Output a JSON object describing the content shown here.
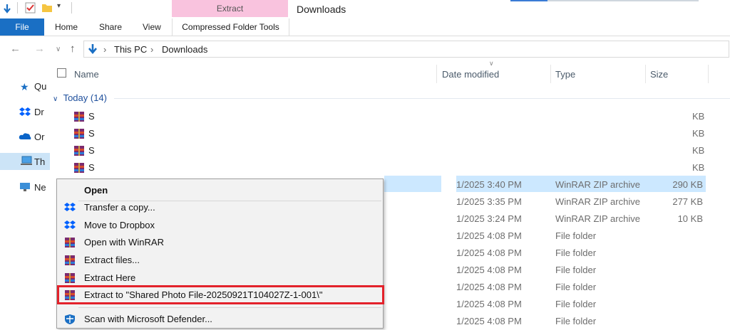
{
  "window": {
    "title": "Downloads"
  },
  "ribbon": {
    "context_tab": "Extract",
    "tabs": [
      "File",
      "Home",
      "Share",
      "View",
      "Compressed Folder Tools"
    ]
  },
  "address": {
    "crumbs": [
      "This PC",
      "Downloads"
    ]
  },
  "columns": {
    "name": "Name",
    "date": "Date modified",
    "type": "Type",
    "size": "Size"
  },
  "group": {
    "label": "Today (14)"
  },
  "sidebar": {
    "items": [
      "Qu",
      "Dr",
      "Or",
      "Th",
      "Ne"
    ]
  },
  "rows": [
    {
      "name": "S",
      "date": "",
      "type": "",
      "size": "KB"
    },
    {
      "name": "S",
      "date": "",
      "type": "",
      "size": "KB"
    },
    {
      "name": "S",
      "date": "",
      "type": "",
      "size": "KB"
    },
    {
      "name": "S",
      "date": "",
      "type": "",
      "size": "KB"
    },
    {
      "date": "1/2025 3:40 PM",
      "type": "WinRAR ZIP archive",
      "size": "290 KB"
    },
    {
      "date": "1/2025 3:35 PM",
      "type": "WinRAR ZIP archive",
      "size": "277 KB"
    },
    {
      "date": "1/2025 3:24 PM",
      "type": "WinRAR ZIP archive",
      "size": "10 KB"
    },
    {
      "date": "1/2025 4:08 PM",
      "type": "File folder",
      "size": ""
    },
    {
      "date": "1/2025 4:08 PM",
      "type": "File folder",
      "size": ""
    },
    {
      "date": "1/2025 4:08 PM",
      "type": "File folder",
      "size": ""
    },
    {
      "date": "1/2025 4:08 PM",
      "type": "File folder",
      "size": ""
    },
    {
      "date": "1/2025 4:08 PM",
      "type": "File folder",
      "size": ""
    },
    {
      "date": "1/2025 4:08 PM",
      "type": "File folder",
      "size": ""
    }
  ],
  "context_menu": {
    "items": [
      "Open",
      "Transfer a copy...",
      "Move to Dropbox",
      "Open with WinRAR",
      "Extract files...",
      "Extract Here",
      "Extract to \"Shared Photo File-20250921T104027Z-1-001\\\"",
      "Scan with Microsoft Defender..."
    ]
  },
  "colors": {
    "accent": "#1a6fc4",
    "selection": "#cce8ff",
    "highlight": "#e3222b",
    "extract_tab": "#f9c3de"
  }
}
